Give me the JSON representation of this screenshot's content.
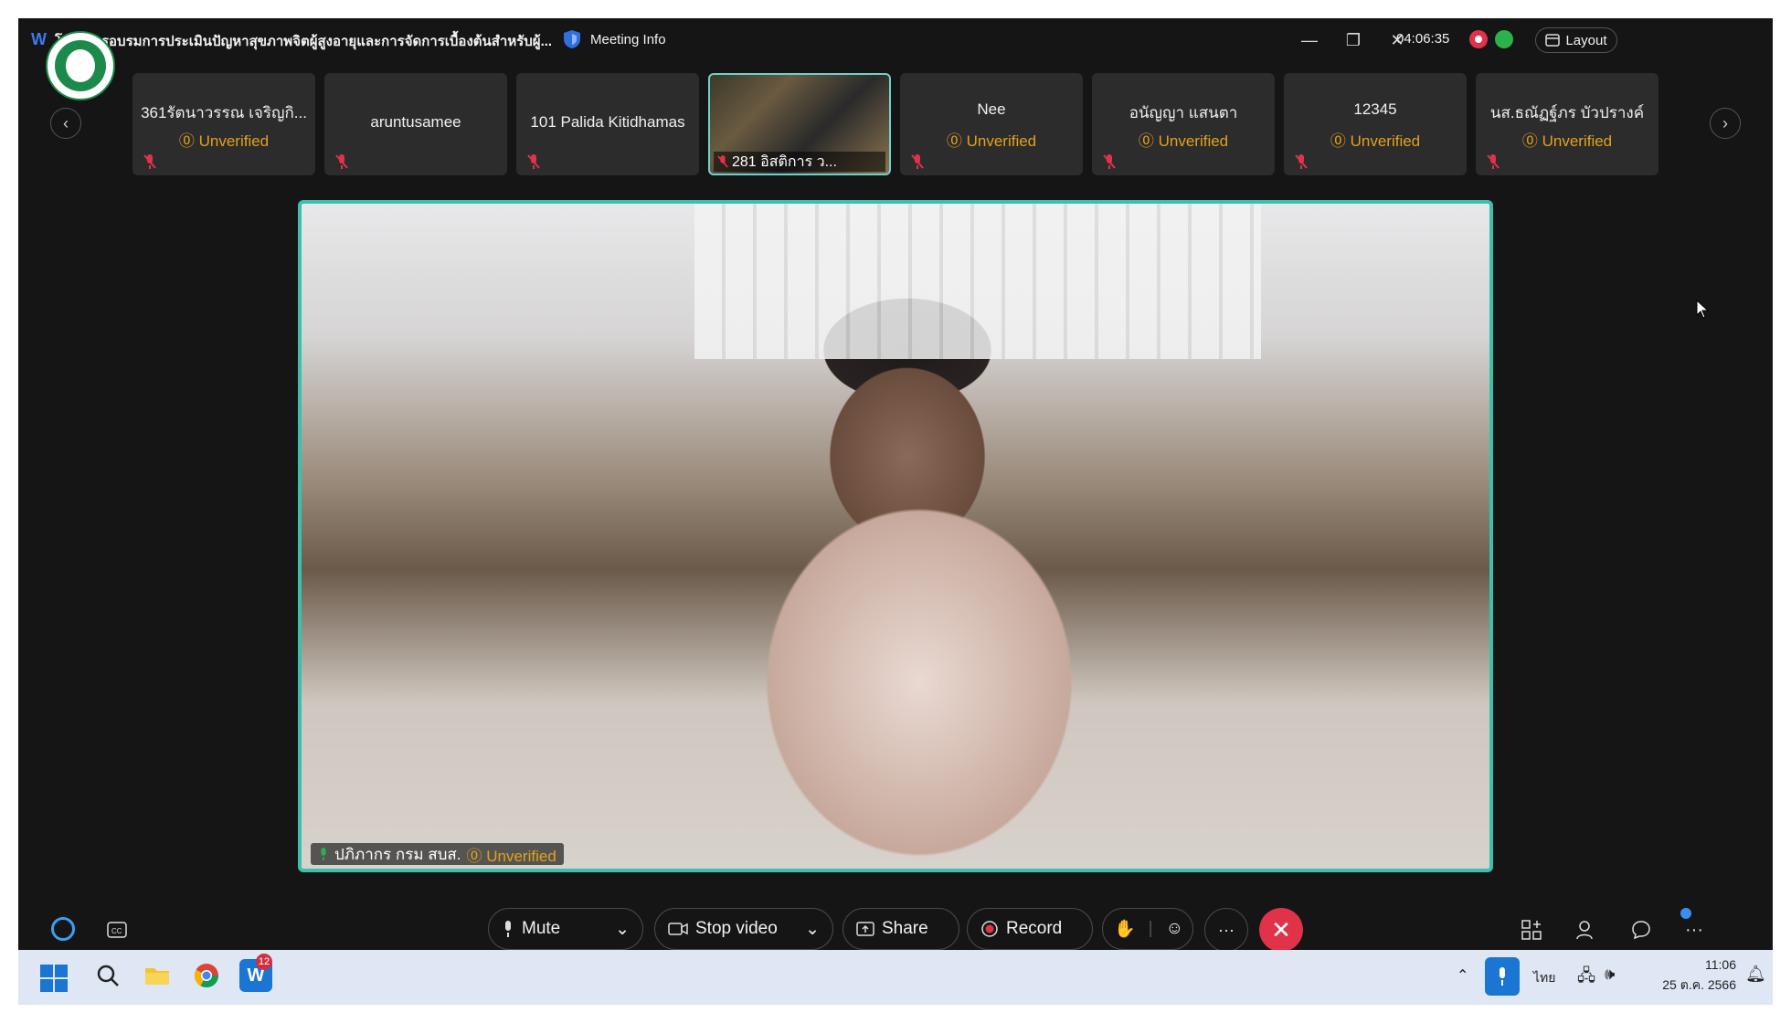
{
  "window": {
    "title": "โครงการอบรมการประเมินปัญหาสุขภาพจิตผู้สูงอายุและการจัดการเบื้องต้นสำหรับผู้...",
    "meeting_info_label": "Meeting Info",
    "timer": "04:06:35",
    "layout_label": "Layout",
    "minimize_glyph": "—",
    "restore_glyph": "❐",
    "close_glyph": "✕"
  },
  "participants": [
    {
      "name": "361รัตนาวรรณ เจริญกิ...",
      "status": "Unverified",
      "video": false
    },
    {
      "name": "aruntusamee",
      "status": "",
      "video": false
    },
    {
      "name": "101 Palida Kitidhamas",
      "status": "",
      "video": false
    },
    {
      "name": "281 อิสติการ ว...",
      "status": "",
      "video": true
    },
    {
      "name": "Nee",
      "status": "Unverified",
      "video": false
    },
    {
      "name": "อนัญญา แสนตา",
      "status": "Unverified",
      "video": false
    },
    {
      "name": "12345",
      "status": "Unverified",
      "video": false
    },
    {
      "name": "นส.ธณัฏฐ์ภร บัวปรางค์",
      "status": "Unverified",
      "video": false
    }
  ],
  "main_video": {
    "speaker_name": "ปภิภากร กรม สบส.",
    "status": "Unverified"
  },
  "controls": {
    "mute_label": "Mute",
    "stop_video_label": "Stop video",
    "share_label": "Share",
    "record_label": "Record",
    "more_glyph": "···",
    "end_glyph": "✕",
    "overflow_glyph": "···"
  },
  "taskbar": {
    "badge_count": "12",
    "language": "ไทย",
    "time": "11:06",
    "date": "25 ต.ค. 2566"
  },
  "colors": {
    "accent_teal": "#3dbfae",
    "unverified": "#e0a21c",
    "end_call": "#e0334a",
    "brand_blue": "#1a76d2"
  },
  "icons": [
    "webex-logo-icon",
    "shield-icon",
    "record-indicator-icon",
    "network-icon",
    "layout-icon",
    "chevron-left-icon",
    "chevron-right-icon",
    "mic-off-icon",
    "mic-icon",
    "video-icon",
    "share-icon",
    "record-icon",
    "raise-hand-icon",
    "reaction-icon",
    "close-icon",
    "apps-icon",
    "participants-icon",
    "chat-icon",
    "search-icon",
    "folder-icon",
    "chrome-icon",
    "webex-icon",
    "windows-icon"
  ]
}
